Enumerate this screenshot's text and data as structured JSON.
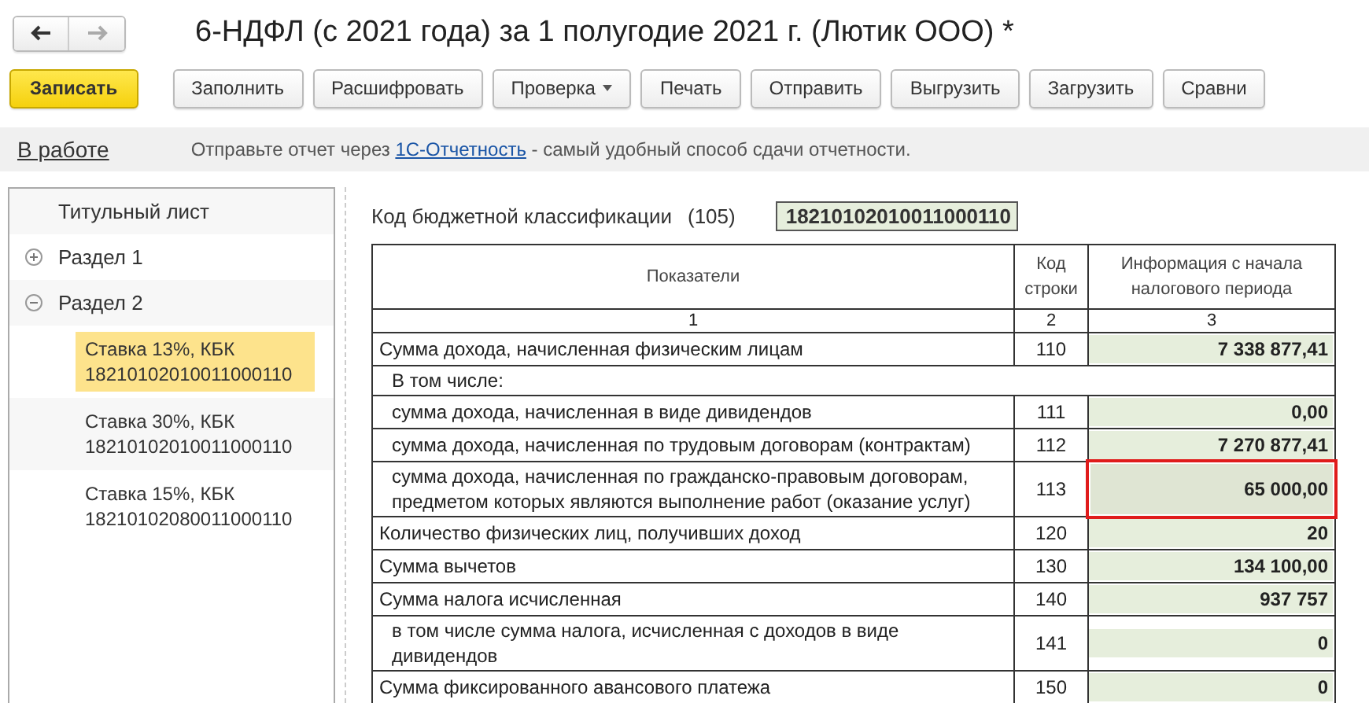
{
  "window": {
    "title": "6-НДФЛ (с 2021 года) за 1 полугодие 2021 г. (Лютик ООО) *"
  },
  "nav": [
    {
      "kind": "back",
      "disabled": false
    },
    {
      "kind": "forward",
      "disabled": true
    }
  ],
  "toolbar": [
    {
      "label": "Записать",
      "kind": "primary"
    },
    {
      "label": "Заполнить",
      "kind": "plain"
    },
    {
      "label": "Расшифровать",
      "kind": "plain"
    },
    {
      "label": "Проверка",
      "kind": "dropdown"
    },
    {
      "label": "Печать",
      "kind": "plain"
    },
    {
      "label": "Отправить",
      "kind": "plain"
    },
    {
      "label": "Выгрузить",
      "kind": "plain"
    },
    {
      "label": "Загрузить",
      "kind": "plain"
    },
    {
      "label": "Сравни",
      "kind": "plain"
    }
  ],
  "info_bar": {
    "status": "В работе",
    "text_before": "Отправьте отчет через",
    "link": "1С-Отчетность",
    "text_after": "- самый удобный способ сдачи отчетности."
  },
  "tree": [
    {
      "label": "Титульный лист",
      "selected": false
    },
    {
      "label": "Раздел 1",
      "selected": false,
      "expanded": false
    },
    {
      "label": "Раздел 2",
      "selected": false,
      "expanded": true,
      "children": [
        {
          "label": "Ставка 13%, КБК 18210102010011000110",
          "selected": true
        },
        {
          "label": "Ставка 30%, КБК 18210102010011000110",
          "selected": false
        },
        {
          "label": "Ставка 15%, КБК 18210102080011000110",
          "selected": false
        }
      ]
    }
  ],
  "kbk": {
    "label": "Код бюджетной классификации",
    "code": "(105)",
    "value": "18210102010011000110"
  },
  "table": {
    "columns": [
      "Показатели",
      "Код строки",
      "Информация с начала налогового периода"
    ],
    "numbers": [
      "1",
      "2",
      "3"
    ],
    "rows": [
      {
        "kind": "main",
        "label": "Сумма дохода, начисленная физическим лицам",
        "code": "110",
        "value": "7 338 877,41",
        "selected": false
      },
      {
        "kind": "heading",
        "label": "В том числе:"
      },
      {
        "kind": "sub",
        "label": "сумма дохода, начисленная в виде дивидендов",
        "code": "111",
        "value": "0,00",
        "selected": false
      },
      {
        "kind": "sub",
        "label": "сумма дохода, начисленная по трудовым договорам (контрактам)",
        "code": "112",
        "value": "7 270 877,41",
        "selected": false
      },
      {
        "kind": "sub",
        "label": "сумма дохода, начисленная по гражданско-правовым договорам, предметом которых являются выполнение работ (оказание услуг)",
        "code": "113",
        "value": "65 000,00",
        "selected": true
      },
      {
        "kind": "main",
        "label": "Количество физических лиц, получивших доход",
        "code": "120",
        "value": "20",
        "selected": false
      },
      {
        "kind": "main",
        "label": "Сумма вычетов",
        "code": "130",
        "value": "134 100,00",
        "selected": false
      },
      {
        "kind": "main",
        "label": "Сумма налога исчисленная",
        "code": "140",
        "value": "937 757",
        "selected": false
      },
      {
        "kind": "sub",
        "label": "в том числе сумма налога, исчисленная с доходов в виде дивидендов",
        "code": "141",
        "value": "0",
        "selected": false
      },
      {
        "kind": "main",
        "label": "Сумма фиксированного авансового платежа",
        "code": "150",
        "value": "0",
        "selected": false
      }
    ]
  }
}
